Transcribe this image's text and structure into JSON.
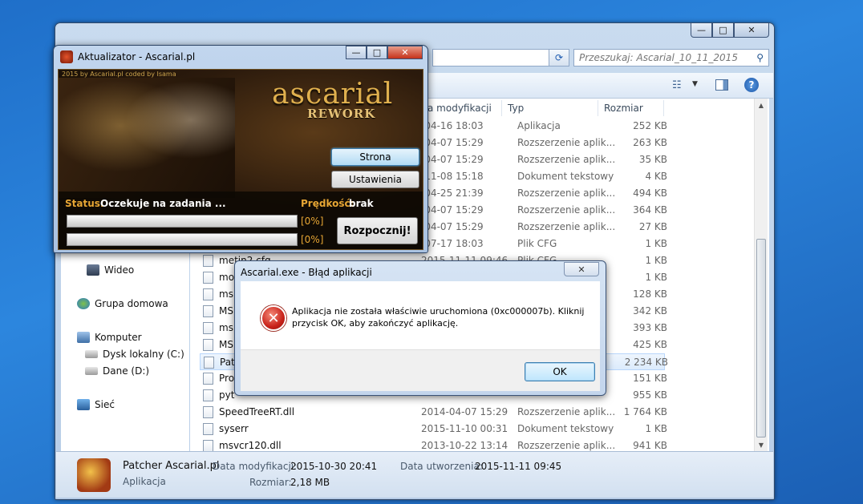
{
  "explorer": {
    "caption_buttons": {
      "minimize": "—",
      "maximize": "□",
      "close": "✕"
    },
    "search_placeholder": "Przeszukaj: Ascarial_10_11_2015",
    "columns": {
      "date": "a modyfikacji",
      "type": "Typ",
      "size": "Rozmiar"
    },
    "nav": [
      {
        "label": "Wideo",
        "icon": "video-library-icon"
      },
      {
        "label": "Grupa domowa",
        "icon": "homegroup-icon"
      },
      {
        "label": "Komputer",
        "icon": "computer-icon"
      },
      {
        "label": "Dysk lokalny (C:)",
        "icon": "drive-icon"
      },
      {
        "label": "Dane (D:)",
        "icon": "drive-icon"
      },
      {
        "label": "Sieć",
        "icon": "network-icon"
      }
    ],
    "files": [
      {
        "name": "",
        "date": "-04-16 18:03",
        "type": "Aplikacja",
        "size": "252 KB"
      },
      {
        "name": "",
        "date": "-04-07 15:29",
        "type": "Rozszerzenie aplik...",
        "size": "263 KB"
      },
      {
        "name": "",
        "date": "-04-07 15:29",
        "type": "Rozszerzenie aplik...",
        "size": "35 KB"
      },
      {
        "name": "",
        "date": "-11-08 15:18",
        "type": "Dokument tekstowy",
        "size": "4 KB"
      },
      {
        "name": "",
        "date": "-04-25 21:39",
        "type": "Rozszerzenie aplik...",
        "size": "494 KB"
      },
      {
        "name": "",
        "date": "-04-07 15:29",
        "type": "Rozszerzenie aplik...",
        "size": "364 KB"
      },
      {
        "name": "",
        "date": "-04-07 15:29",
        "type": "Rozszerzenie aplik...",
        "size": "27 KB"
      },
      {
        "name": "",
        "date": "-07-17 18:03",
        "type": "Plik CFG",
        "size": "1 KB"
      },
      {
        "name": "metin2.cfg",
        "date": "2015-11-11 09:46",
        "type": "Plik CFG",
        "size": "1 KB"
      },
      {
        "name": "mo",
        "date": "",
        "type": "",
        "size": "1 KB"
      },
      {
        "name": "ms",
        "date": "",
        "type": "",
        "size": "128 KB"
      },
      {
        "name": "MS",
        "date": "",
        "type": "",
        "size": "342 KB"
      },
      {
        "name": "ms",
        "date": "",
        "type": "",
        "size": "393 KB"
      },
      {
        "name": "MS",
        "date": "",
        "type": "",
        "size": "425 KB"
      },
      {
        "name": "Pat",
        "date": "",
        "type": "",
        "size": "2 234 KB"
      },
      {
        "name": "Pro",
        "date": "",
        "type": "",
        "size": "151 KB"
      },
      {
        "name": "pyt",
        "date": "",
        "type": "",
        "size": "955 KB"
      },
      {
        "name": "SpeedTreeRT.dll",
        "date": "2014-04-07 15:29",
        "type": "Rozszerzenie aplik...",
        "size": "1 764 KB"
      },
      {
        "name": "syserr",
        "date": "2015-11-10 00:31",
        "type": "Dokument tekstowy",
        "size": "1 KB"
      },
      {
        "name": "msvcr120.dll",
        "date": "2013-10-22 13:14",
        "type": "Rozszerzenie aplik...",
        "size": "941 KB"
      }
    ],
    "details": {
      "name": "Patcher Ascarial.pl",
      "kind": "Aplikacja",
      "modified_label": "Data modyfikacji:",
      "modified_value": "2015-10-30 20:41",
      "created_label": "Data utworzenia:",
      "created_value": "2015-11-11 09:45",
      "size_label": "Rozmiar:",
      "size_value": "2,18 MB"
    }
  },
  "updater": {
    "title": "Aktualizator - Ascarial.pl",
    "credit": "2015 by Ascarial.pl coded by Isama",
    "logo_name": "ascarial",
    "logo_sub": "REWORK",
    "btn_strona": "Strona",
    "btn_ustawienia": "Ustawienia",
    "btn_start": "Rozpocznij!",
    "status_label": "Status:",
    "status_value": "Oczekuje na zadania ...",
    "speed_label": "Prędkość:",
    "speed_value": "brak",
    "progress1": "[0%]",
    "progress2": "[0%]",
    "progress1_value": 0,
    "progress2_value": 0
  },
  "error_dialog": {
    "title": "Ascarial.exe - Błąd aplikacji",
    "message": "Aplikacja nie została właściwie uruchomiona (0xc000007b). Kliknij przycisk OK, aby zakończyć aplikację.",
    "ok": "OK"
  },
  "colors": {
    "status_label": "#e7a634",
    "status_value": "#ffffff",
    "logo_gold": "#e0b04e"
  }
}
